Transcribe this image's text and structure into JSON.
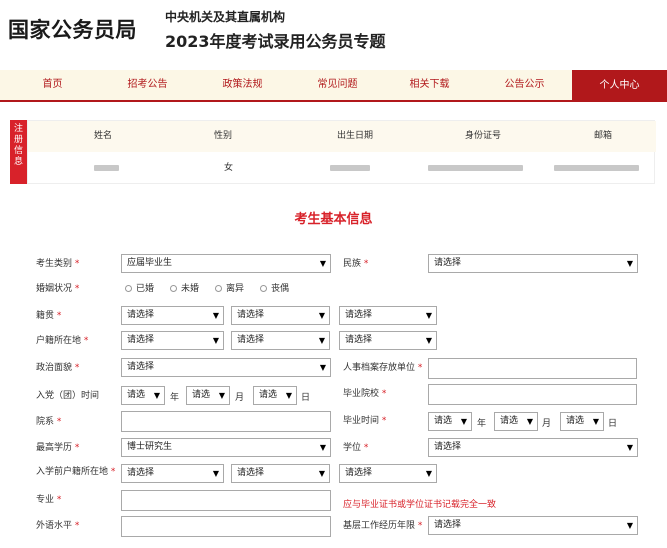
{
  "header": {
    "site_name": "国家公务员局",
    "subtitle_line1": "中央机关及其直属机构",
    "subtitle_line2": "2023年度考试录用公务员专题"
  },
  "nav": {
    "items": [
      "首页",
      "招考公告",
      "政策法规",
      "常见问题",
      "相关下载",
      "公告公示",
      "个人中心"
    ],
    "active": "个人中心"
  },
  "registration": {
    "side_label": [
      "注",
      "册",
      "信",
      "息"
    ],
    "columns": [
      "姓名",
      "性别",
      "出生日期",
      "身份证号",
      "邮箱"
    ],
    "gender_value": "女"
  },
  "form": {
    "title": "考生基本信息",
    "required_mark": "*",
    "placeholder_select": "请选择",
    "placeholder_select_short": "请选",
    "arrow": "▼",
    "labels": {
      "candidate_type": "考生类别",
      "ethnicity": "民族",
      "marital": "婚姻状况",
      "native_place": "籍贯",
      "household": "户籍所在地",
      "political": "政治面貌",
      "archive_unit": "人事档案存放单位",
      "party_time": "入党（团）时间",
      "graduate_school": "毕业院校",
      "department": "院系",
      "graduate_time": "毕业时间",
      "education": "最高学历",
      "degree": "学位",
      "pre_enroll_household": "入学前户籍所在地",
      "major": "专业",
      "foreign_lang": "外语水平",
      "grassroots_years": "基层工作经历年限"
    },
    "values": {
      "candidate_type": "应届毕业生",
      "education": "博士研究生"
    },
    "marital_options": [
      "已婚",
      "未婚",
      "离异",
      "丧偶"
    ],
    "units": {
      "year": "年",
      "month": "月",
      "day": "日"
    },
    "major_warning": "应与毕业证书或学位证书记载完全一致"
  }
}
